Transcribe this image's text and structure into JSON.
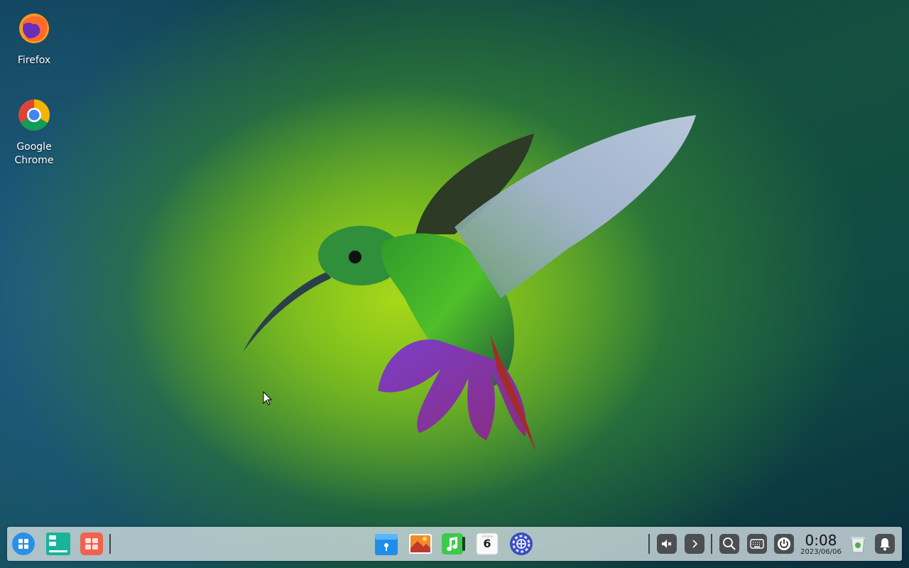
{
  "desktop": {
    "icons": [
      {
        "label": "Firefox",
        "icon": "firefox-icon"
      },
      {
        "label": "Google\nChrome",
        "icon": "chrome-icon"
      }
    ]
  },
  "wallpaper": {
    "subject": "hummingbird"
  },
  "taskbar": {
    "left_launchers": [
      "launcher-icon",
      "multitasking-view-icon",
      "desktop-grid-icon"
    ],
    "apps": [
      "file-manager-icon",
      "image-viewer-icon",
      "music-icon",
      "calendar-icon",
      "control-center-icon"
    ],
    "calendar_day": "6",
    "tray": [
      "volume-muted-icon",
      "expand-tray-icon",
      "search-icon",
      "keyboard-icon",
      "power-icon"
    ],
    "clock": {
      "time": "0:08",
      "date": "2023/06/06"
    },
    "trash": "trash-icon",
    "notifications": "bell-icon"
  },
  "colors": {
    "taskbar_bg": "#d7e1e6",
    "accent_blue": "#2b8fe6"
  }
}
